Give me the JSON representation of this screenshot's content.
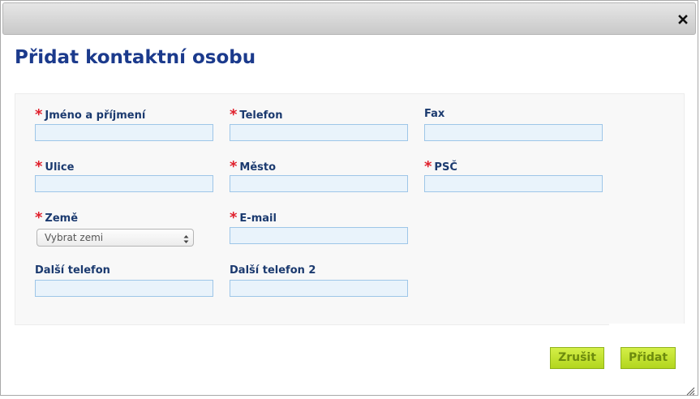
{
  "dialog": {
    "title": "Přidat kontaktní osobu"
  },
  "form": {
    "required_marker": "*",
    "fields": {
      "full_name": {
        "label": "Jméno a příjmení",
        "value": ""
      },
      "phone": {
        "label": "Telefon",
        "value": ""
      },
      "fax": {
        "label": "Fax",
        "value": ""
      },
      "street": {
        "label": "Ulice",
        "value": ""
      },
      "city": {
        "label": "Město",
        "value": ""
      },
      "postcode": {
        "label": "PSČ",
        "value": ""
      },
      "country": {
        "label": "Země",
        "selected": "Vybrat zemi"
      },
      "email": {
        "label": "E-mail",
        "value": ""
      },
      "other_phone": {
        "label": "Další telefon",
        "value": ""
      },
      "other_phone_2": {
        "label": "Další telefon 2",
        "value": ""
      }
    }
  },
  "buttons": {
    "cancel_label": "Zrušit",
    "add_label": "Přidat"
  },
  "icons": {
    "close": "close-icon",
    "select_arrows": "updown-arrows-icon",
    "resize": "resize-grip-icon"
  },
  "colors": {
    "title": "#1b3a8c",
    "label": "#1b3a6f",
    "required": "#e0202c",
    "input_bg": "#e9f3fb",
    "input_border": "#9ec6e8",
    "button_bg": "#c4e332",
    "button_text": "#6d8b0e"
  }
}
